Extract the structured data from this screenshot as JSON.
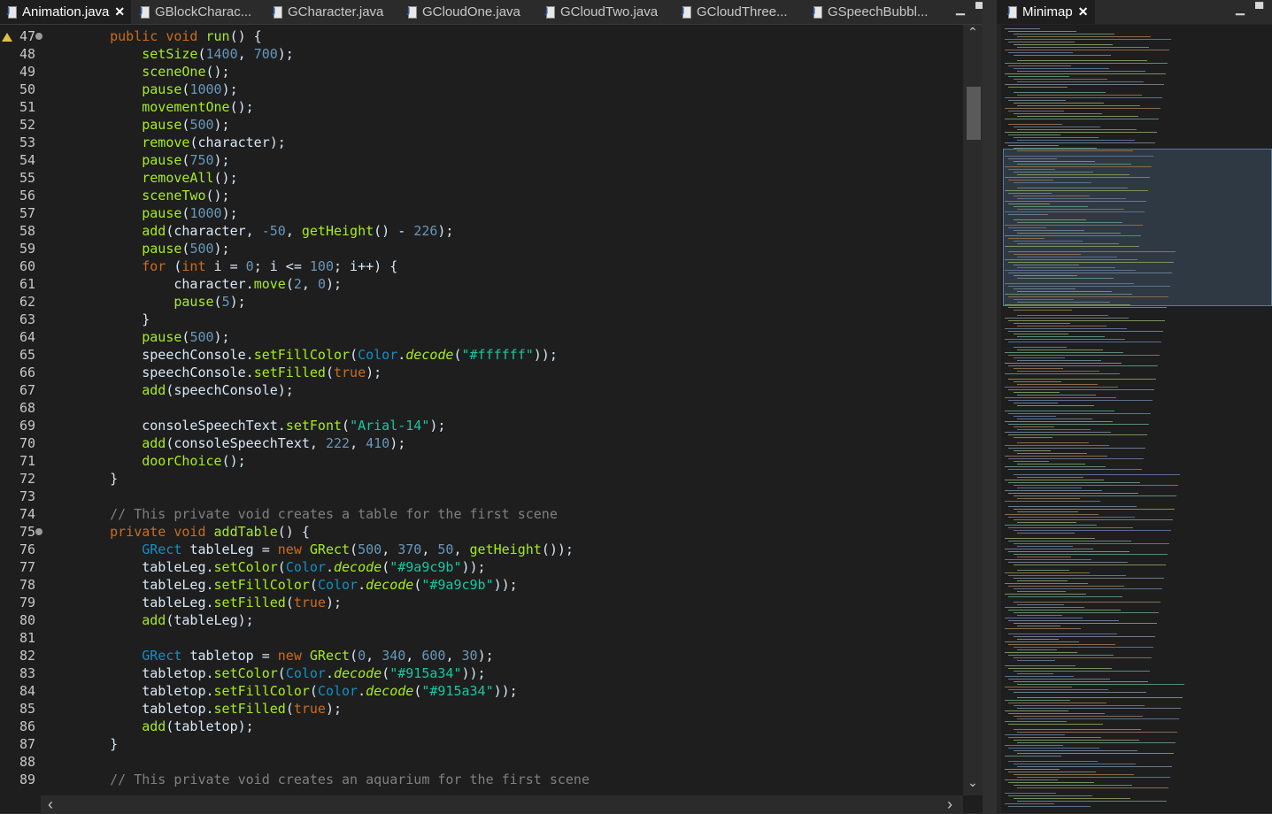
{
  "editor": {
    "tabs": [
      {
        "label": "Animation.java",
        "active": true,
        "close_glyph": "✕"
      },
      {
        "label": "GBlockCharac...",
        "active": false
      },
      {
        "label": "GCharacter.java",
        "active": false
      },
      {
        "label": "GCloudOne.java",
        "active": false
      },
      {
        "label": "GCloudTwo.java",
        "active": false
      },
      {
        "label": "GCloudThree...",
        "active": false
      },
      {
        "label": "GSpeechBubbl...",
        "active": false
      }
    ],
    "window_controls": {
      "minimize": "▁",
      "maximize": "▀"
    },
    "scroll_glyphs": {
      "up": "⌃",
      "down": "⌄",
      "left": "‹",
      "right": "›"
    },
    "lines": [
      {
        "n": 47,
        "fold": true,
        "warn": true,
        "t": [
          [
            "    ",
            ""
          ],
          [
            "public ",
            "k"
          ],
          [
            "void ",
            "k"
          ],
          [
            "run",
            "m"
          ],
          [
            "() {",
            ""
          ]
        ]
      },
      {
        "n": 48,
        "t": [
          [
            "        ",
            ""
          ],
          [
            "setSize",
            "m"
          ],
          [
            "(",
            ""
          ],
          [
            "1400",
            "n"
          ],
          [
            ", ",
            ""
          ],
          [
            "700",
            "n"
          ],
          [
            ");",
            ""
          ]
        ]
      },
      {
        "n": 49,
        "t": [
          [
            "        ",
            ""
          ],
          [
            "sceneOne",
            "m"
          ],
          [
            "();",
            ""
          ]
        ]
      },
      {
        "n": 50,
        "t": [
          [
            "        ",
            ""
          ],
          [
            "pause",
            "m"
          ],
          [
            "(",
            ""
          ],
          [
            "1000",
            "n"
          ],
          [
            ");",
            ""
          ]
        ]
      },
      {
        "n": 51,
        "t": [
          [
            "        ",
            ""
          ],
          [
            "movementOne",
            "m"
          ],
          [
            "();",
            ""
          ]
        ]
      },
      {
        "n": 52,
        "t": [
          [
            "        ",
            ""
          ],
          [
            "pause",
            "m"
          ],
          [
            "(",
            ""
          ],
          [
            "500",
            "n"
          ],
          [
            ");",
            ""
          ]
        ]
      },
      {
        "n": 53,
        "t": [
          [
            "        ",
            ""
          ],
          [
            "remove",
            "m"
          ],
          [
            "(character);",
            ""
          ]
        ]
      },
      {
        "n": 54,
        "t": [
          [
            "        ",
            ""
          ],
          [
            "pause",
            "m"
          ],
          [
            "(",
            ""
          ],
          [
            "750",
            "n"
          ],
          [
            ");",
            ""
          ]
        ]
      },
      {
        "n": 55,
        "t": [
          [
            "        ",
            ""
          ],
          [
            "removeAll",
            "m"
          ],
          [
            "();",
            ""
          ]
        ]
      },
      {
        "n": 56,
        "t": [
          [
            "        ",
            ""
          ],
          [
            "sceneTwo",
            "m"
          ],
          [
            "();",
            ""
          ]
        ]
      },
      {
        "n": 57,
        "t": [
          [
            "        ",
            ""
          ],
          [
            "pause",
            "m"
          ],
          [
            "(",
            ""
          ],
          [
            "1000",
            "n"
          ],
          [
            ");",
            ""
          ]
        ]
      },
      {
        "n": 58,
        "t": [
          [
            "        ",
            ""
          ],
          [
            "add",
            "m"
          ],
          [
            "(character, ",
            ""
          ],
          [
            "-50",
            "n"
          ],
          [
            ", ",
            ""
          ],
          [
            "getHeight",
            "m"
          ],
          [
            "() - ",
            ""
          ],
          [
            "226",
            "n"
          ],
          [
            ");",
            ""
          ]
        ]
      },
      {
        "n": 59,
        "t": [
          [
            "        ",
            ""
          ],
          [
            "pause",
            "m"
          ],
          [
            "(",
            ""
          ],
          [
            "500",
            "n"
          ],
          [
            ");",
            ""
          ]
        ]
      },
      {
        "n": 60,
        "t": [
          [
            "        ",
            ""
          ],
          [
            "for ",
            "k"
          ],
          [
            "(",
            ""
          ],
          [
            "int ",
            "k"
          ],
          [
            "i = ",
            ""
          ],
          [
            "0",
            "n"
          ],
          [
            "; i <= ",
            ""
          ],
          [
            "100",
            "n"
          ],
          [
            "; i++) {",
            ""
          ]
        ]
      },
      {
        "n": 61,
        "t": [
          [
            "            ",
            ""
          ],
          [
            "character.",
            ""
          ],
          [
            "move",
            "m"
          ],
          [
            "(",
            ""
          ],
          [
            "2",
            "n"
          ],
          [
            ", ",
            ""
          ],
          [
            "0",
            "n"
          ],
          [
            ");",
            ""
          ]
        ]
      },
      {
        "n": 62,
        "t": [
          [
            "            ",
            ""
          ],
          [
            "pause",
            "m"
          ],
          [
            "(",
            ""
          ],
          [
            "5",
            "n"
          ],
          [
            ");",
            ""
          ]
        ]
      },
      {
        "n": 63,
        "t": [
          [
            "        }",
            ""
          ]
        ]
      },
      {
        "n": 64,
        "t": [
          [
            "        ",
            ""
          ],
          [
            "pause",
            "m"
          ],
          [
            "(",
            ""
          ],
          [
            "500",
            "n"
          ],
          [
            ");",
            ""
          ]
        ]
      },
      {
        "n": 65,
        "t": [
          [
            "        ",
            ""
          ],
          [
            "speechConsole.",
            ""
          ],
          [
            "setFillColor",
            "m"
          ],
          [
            "(",
            ""
          ],
          [
            "Color",
            "t"
          ],
          [
            ".",
            ""
          ],
          [
            "decode",
            "m it"
          ],
          [
            "(",
            ""
          ],
          [
            "\"#ffffff\"",
            "s"
          ],
          [
            "));",
            ""
          ]
        ]
      },
      {
        "n": 66,
        "t": [
          [
            "        ",
            ""
          ],
          [
            "speechConsole.",
            ""
          ],
          [
            "setFilled",
            "m"
          ],
          [
            "(",
            ""
          ],
          [
            "true",
            "k"
          ],
          [
            ");",
            ""
          ]
        ]
      },
      {
        "n": 67,
        "t": [
          [
            "        ",
            ""
          ],
          [
            "add",
            "m"
          ],
          [
            "(speechConsole);",
            ""
          ]
        ]
      },
      {
        "n": 68,
        "t": []
      },
      {
        "n": 69,
        "t": [
          [
            "        ",
            ""
          ],
          [
            "consoleSpeechText.",
            ""
          ],
          [
            "setFont",
            "m"
          ],
          [
            "(",
            ""
          ],
          [
            "\"Arial-14\"",
            "s"
          ],
          [
            ");",
            ""
          ]
        ]
      },
      {
        "n": 70,
        "t": [
          [
            "        ",
            ""
          ],
          [
            "add",
            "m"
          ],
          [
            "(consoleSpeechText, ",
            ""
          ],
          [
            "222",
            "n"
          ],
          [
            ", ",
            ""
          ],
          [
            "410",
            "n"
          ],
          [
            ");",
            ""
          ]
        ]
      },
      {
        "n": 71,
        "t": [
          [
            "        ",
            ""
          ],
          [
            "doorChoice",
            "m"
          ],
          [
            "();",
            ""
          ]
        ]
      },
      {
        "n": 72,
        "t": [
          [
            "    }",
            ""
          ]
        ]
      },
      {
        "n": 73,
        "t": []
      },
      {
        "n": 74,
        "t": [
          [
            "    ",
            ""
          ],
          [
            "// This private void creates a table for the first scene",
            "c"
          ]
        ]
      },
      {
        "n": 75,
        "fold": true,
        "t": [
          [
            "    ",
            ""
          ],
          [
            "private ",
            "k"
          ],
          [
            "void ",
            "k"
          ],
          [
            "addTable",
            "m"
          ],
          [
            "() {",
            ""
          ]
        ]
      },
      {
        "n": 76,
        "t": [
          [
            "        ",
            ""
          ],
          [
            "GRect ",
            "t"
          ],
          [
            "tableLeg = ",
            ""
          ],
          [
            "new ",
            "k"
          ],
          [
            "GRect",
            "m"
          ],
          [
            "(",
            ""
          ],
          [
            "500",
            "n"
          ],
          [
            ", ",
            ""
          ],
          [
            "370",
            "n"
          ],
          [
            ", ",
            ""
          ],
          [
            "50",
            "n"
          ],
          [
            ", ",
            ""
          ],
          [
            "getHeight",
            "m"
          ],
          [
            "());",
            ""
          ]
        ]
      },
      {
        "n": 77,
        "t": [
          [
            "        ",
            ""
          ],
          [
            "tableLeg.",
            ""
          ],
          [
            "setColor",
            "m"
          ],
          [
            "(",
            ""
          ],
          [
            "Color",
            "t"
          ],
          [
            ".",
            ""
          ],
          [
            "decode",
            "m it"
          ],
          [
            "(",
            ""
          ],
          [
            "\"#9a9c9b\"",
            "s"
          ],
          [
            "));",
            ""
          ]
        ]
      },
      {
        "n": 78,
        "t": [
          [
            "        ",
            ""
          ],
          [
            "tableLeg.",
            ""
          ],
          [
            "setFillColor",
            "m"
          ],
          [
            "(",
            ""
          ],
          [
            "Color",
            "t"
          ],
          [
            ".",
            ""
          ],
          [
            "decode",
            "m it"
          ],
          [
            "(",
            ""
          ],
          [
            "\"#9a9c9b\"",
            "s"
          ],
          [
            "));",
            ""
          ]
        ]
      },
      {
        "n": 79,
        "t": [
          [
            "        ",
            ""
          ],
          [
            "tableLeg.",
            ""
          ],
          [
            "setFilled",
            "m"
          ],
          [
            "(",
            ""
          ],
          [
            "true",
            "k"
          ],
          [
            ");",
            ""
          ]
        ]
      },
      {
        "n": 80,
        "t": [
          [
            "        ",
            ""
          ],
          [
            "add",
            "m"
          ],
          [
            "(tableLeg);",
            ""
          ]
        ]
      },
      {
        "n": 81,
        "t": []
      },
      {
        "n": 82,
        "t": [
          [
            "        ",
            ""
          ],
          [
            "GRect ",
            "t"
          ],
          [
            "tabletop = ",
            ""
          ],
          [
            "new ",
            "k"
          ],
          [
            "GRect",
            "m"
          ],
          [
            "(",
            ""
          ],
          [
            "0",
            "n"
          ],
          [
            ", ",
            ""
          ],
          [
            "340",
            "n"
          ],
          [
            ", ",
            ""
          ],
          [
            "600",
            "n"
          ],
          [
            ", ",
            ""
          ],
          [
            "30",
            "n"
          ],
          [
            ");",
            ""
          ]
        ]
      },
      {
        "n": 83,
        "t": [
          [
            "        ",
            ""
          ],
          [
            "tabletop.",
            ""
          ],
          [
            "setColor",
            "m"
          ],
          [
            "(",
            ""
          ],
          [
            "Color",
            "t"
          ],
          [
            ".",
            ""
          ],
          [
            "decode",
            "m it"
          ],
          [
            "(",
            ""
          ],
          [
            "\"#915a34\"",
            "s"
          ],
          [
            "));",
            ""
          ]
        ]
      },
      {
        "n": 84,
        "t": [
          [
            "        ",
            ""
          ],
          [
            "tabletop.",
            ""
          ],
          [
            "setFillColor",
            "m"
          ],
          [
            "(",
            ""
          ],
          [
            "Color",
            "t"
          ],
          [
            ".",
            ""
          ],
          [
            "decode",
            "m it"
          ],
          [
            "(",
            ""
          ],
          [
            "\"#915a34\"",
            "s"
          ],
          [
            "));",
            ""
          ]
        ]
      },
      {
        "n": 85,
        "t": [
          [
            "        ",
            ""
          ],
          [
            "tabletop.",
            ""
          ],
          [
            "setFilled",
            "m"
          ],
          [
            "(",
            ""
          ],
          [
            "true",
            "k"
          ],
          [
            ");",
            ""
          ]
        ]
      },
      {
        "n": 86,
        "t": [
          [
            "        ",
            ""
          ],
          [
            "add",
            "m"
          ],
          [
            "(tabletop);",
            ""
          ]
        ]
      },
      {
        "n": 87,
        "t": [
          [
            "    }",
            ""
          ]
        ]
      },
      {
        "n": 88,
        "t": []
      },
      {
        "n": 89,
        "t": [
          [
            "    ",
            ""
          ],
          [
            "// This private void creates an aquarium for the first scene",
            "c"
          ]
        ]
      }
    ]
  },
  "minimap": {
    "tab_label": "Minimap",
    "close_glyph": "✕",
    "window_controls": {
      "minimize": "▁",
      "maximize": "▀"
    }
  },
  "colors": {
    "keyword": "#cc6c1d",
    "method": "#a7ec21",
    "string": "#17c6a3",
    "number": "#6897bb",
    "comment": "#808080",
    "type": "#1290c3",
    "default_text": "#d9e8f7",
    "background": "#1e1e1e"
  }
}
